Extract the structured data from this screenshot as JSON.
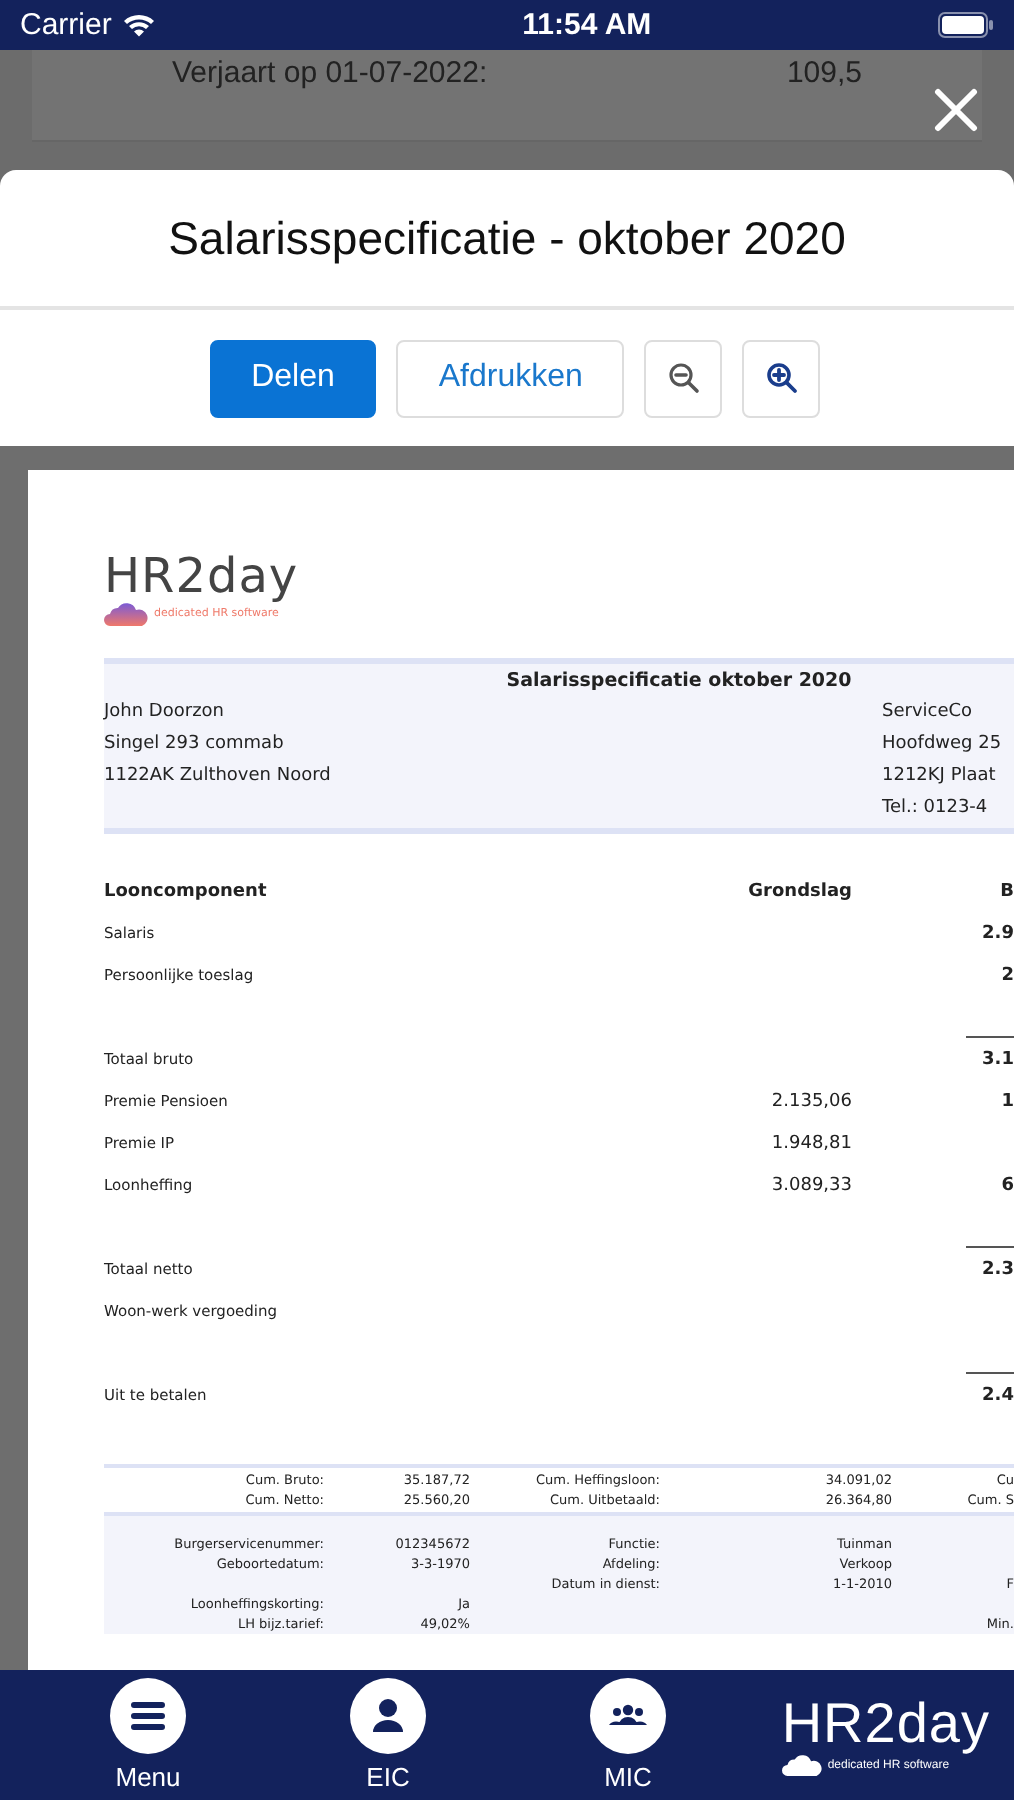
{
  "status_bar": {
    "carrier": "Carrier",
    "time": "11:54 AM"
  },
  "backdrop": {
    "label": "Verjaart op 01-07-2022:",
    "value": "109,5"
  },
  "modal": {
    "title": "Salarisspecificatie - oktober 2020",
    "buttons": [
      {
        "label": "Delen",
        "kind": "primary"
      },
      {
        "label": "Afdrukken",
        "kind": "secondary"
      }
    ]
  },
  "document": {
    "logo": "HR2day",
    "tagline": "dedicated HR software",
    "title": "Salarisspecificatie oktober 2020",
    "employee": [
      "John Doorzon",
      "Singel 293 commab",
      "1122AK Zulthoven Noord"
    ],
    "employer": [
      "ServiceCo",
      "Hoofdweg 25",
      "1212KJ Plaat",
      "Tel.: 0123-4"
    ],
    "columns": [
      "Looncomponent",
      "Grondslag",
      "B"
    ],
    "rows": [
      {
        "label": "Salaris",
        "column_3": "2.9"
      },
      {
        "label": "Persoonlijke toeslag",
        "column_3": "2"
      },
      {
        "label": "Totaal bruto",
        "column_3": "3.1",
        "rule": true
      },
      {
        "label": "Premie Pensioen",
        "grondslag": "2.135,06",
        "column_3": "1"
      },
      {
        "label": "Premie IP",
        "grondslag": "1.948,81"
      },
      {
        "label": "Loonheffing",
        "grondslag": "3.089,33",
        "column_3": "6"
      },
      {
        "label": "Totaal netto",
        "column_3": "2.3",
        "rule": true
      },
      {
        "label": "Woon-werk vergoeding"
      },
      {
        "label": "Uit te betalen",
        "column_3": "2.4",
        "rule": true
      }
    ],
    "cumulative": [
      [
        "Cum. Bruto:",
        "35.187,72",
        "Cum. Heffingsloon:",
        "34.091,02",
        "Cu"
      ],
      [
        "Cum. Netto:",
        "25.560,20",
        "Cum. Uitbetaald:",
        "26.364,80",
        "Cum. S"
      ]
    ],
    "details": [
      {
        "label": "Burgerservicenummer:",
        "value": "012345672",
        "label_2": "Functie:",
        "value_2": "Tuinman"
      },
      {
        "label": "Geboortedatum:",
        "value": "3-3-1970",
        "label_2": "Afdeling:",
        "value_2": "Verkoop"
      },
      {
        "label_2": "Datum in dienst:",
        "value_2": "1-1-2010",
        "column_5": "F"
      },
      {
        "label": "Loonheffingskorting:",
        "value": "Ja"
      },
      {
        "label": "LH bijz.tarief:",
        "value": "49,02%",
        "column_5": "Min."
      }
    ]
  },
  "tab_bar": {
    "items": [
      {
        "label": "Menu"
      },
      {
        "label": "EIC"
      },
      {
        "label": "MIC"
      }
    ],
    "logo": "HR2day",
    "tagline": "dedicated HR software"
  }
}
